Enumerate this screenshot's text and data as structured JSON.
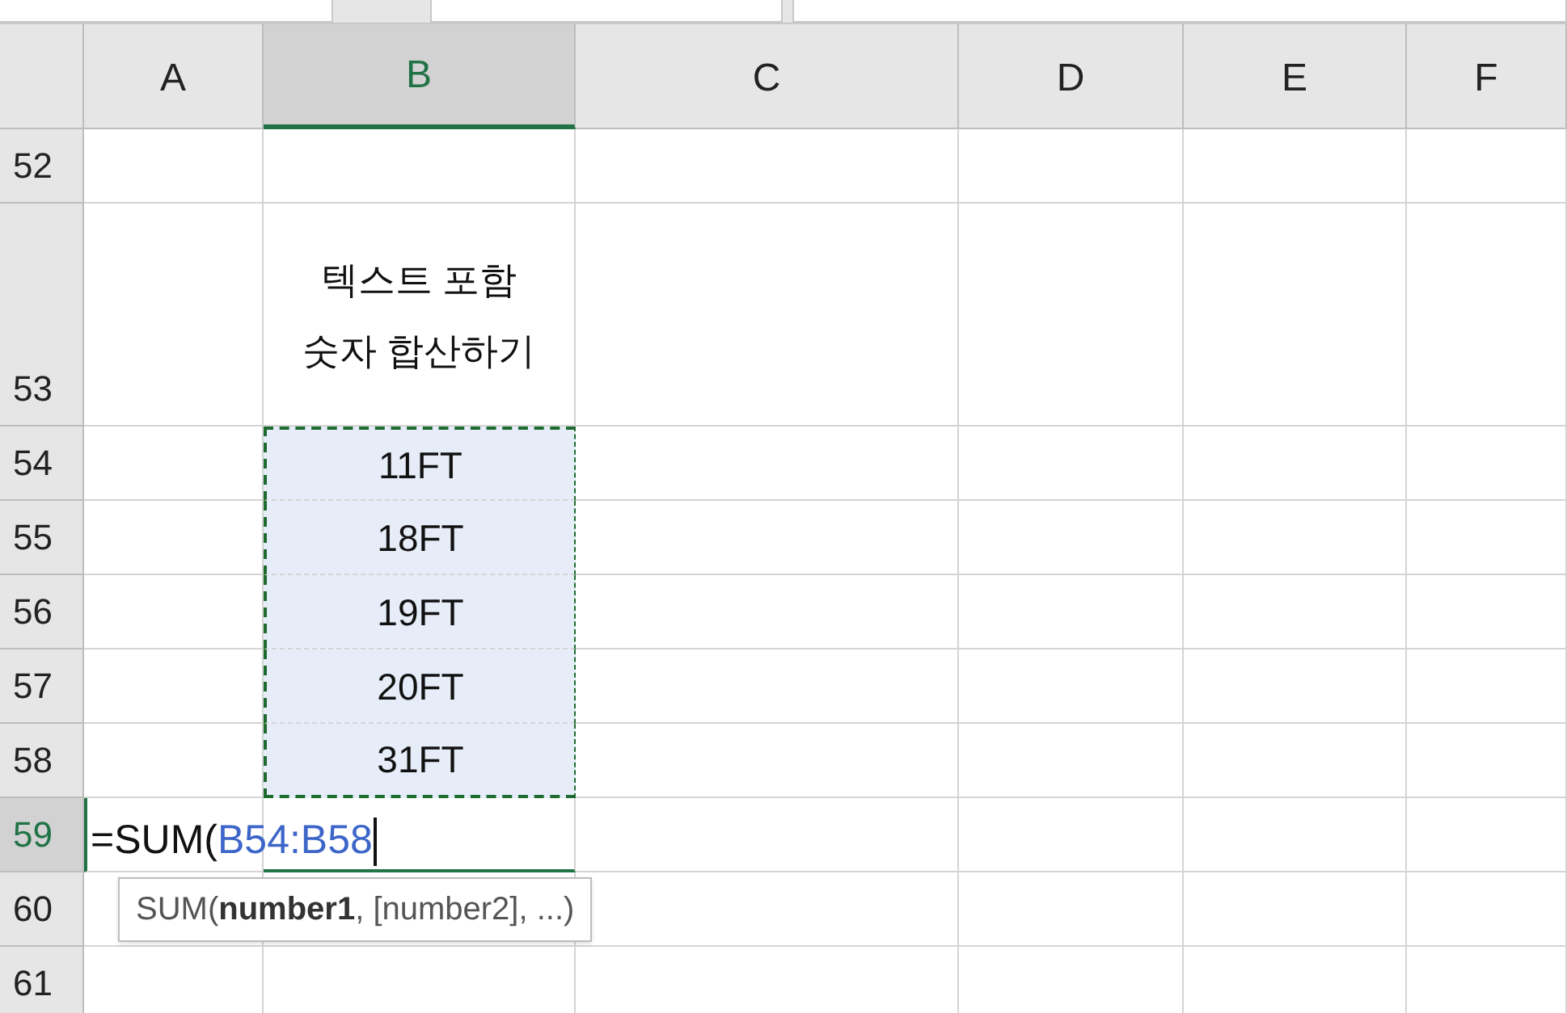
{
  "columns": [
    {
      "label": "A",
      "selected": false
    },
    {
      "label": "B",
      "selected": true
    },
    {
      "label": "C",
      "selected": false
    },
    {
      "label": "D",
      "selected": false
    },
    {
      "label": "E",
      "selected": false
    },
    {
      "label": "F",
      "selected": false
    }
  ],
  "rows": [
    {
      "label": "52",
      "selected": false
    },
    {
      "label": "53",
      "selected": false,
      "b_cell": {
        "text": "텍스트 포함\n숫자 합산하기",
        "selected": false
      }
    },
    {
      "label": "54",
      "selected": false,
      "b_cell": {
        "text": "11FT",
        "selected": true
      }
    },
    {
      "label": "55",
      "selected": false,
      "b_cell": {
        "text": "18FT",
        "selected": true
      }
    },
    {
      "label": "56",
      "selected": false,
      "b_cell": {
        "text": "19FT",
        "selected": true
      }
    },
    {
      "label": "57",
      "selected": false,
      "b_cell": {
        "text": "20FT",
        "selected": true
      }
    },
    {
      "label": "58",
      "selected": false,
      "b_cell": {
        "text": "31FT",
        "selected": true
      }
    },
    {
      "label": "59",
      "selected": true,
      "a_cell": {
        "parts": [
          {
            "kind": "plain",
            "text": "=SUM("
          },
          {
            "kind": "reference",
            "text": "B54:B58"
          }
        ]
      }
    },
    {
      "label": "60",
      "selected": false
    },
    {
      "label": "61",
      "selected": false
    }
  ],
  "tooltip": {
    "text": "SUM(**number1**, [number2], ...)"
  }
}
